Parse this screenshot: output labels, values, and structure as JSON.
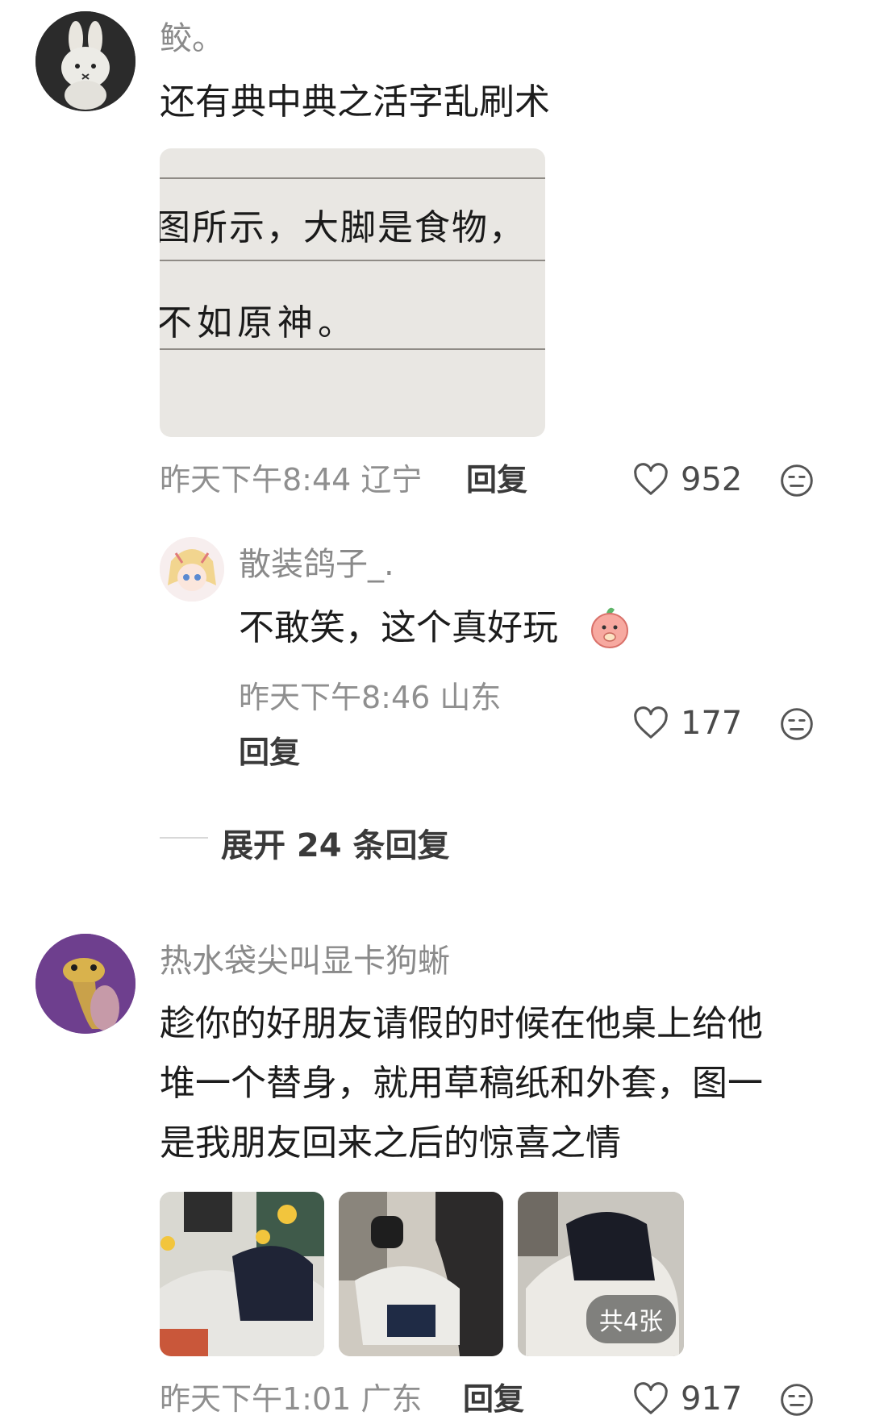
{
  "comments": [
    {
      "username": "鲛。",
      "text": "还有典中典之活字乱刷术",
      "image_text_line1": "图所示，大脚是食物，",
      "image_text_line2": "不如原神。",
      "meta": "昨天下午8:44 辽宁",
      "reply_label": "回复",
      "likes": "952"
    },
    {
      "username": "热水袋尖叫显卡狗蜥",
      "text_lines": [
        "趁你的好朋友请假的时候在他桌上给他",
        "堆一个替身，就用草稿纸和外套，图一",
        "是我朋友回来之后的惊喜之情"
      ],
      "image_count_badge": "共4张",
      "meta": "昨天下午1:01 广东",
      "reply_label": "回复",
      "likes": "917"
    }
  ],
  "sub_reply": {
    "username": "散装鸽子_.",
    "text": "不敢笑，这个真好玩",
    "meta": "昨天下午8:46 山东",
    "reply_label": "回复",
    "likes": "177"
  },
  "expand_replies": "展开 24 条回复",
  "icons": [
    "heart-outline-icon",
    "neutral-face-icon",
    "peach-emoji-icon"
  ]
}
